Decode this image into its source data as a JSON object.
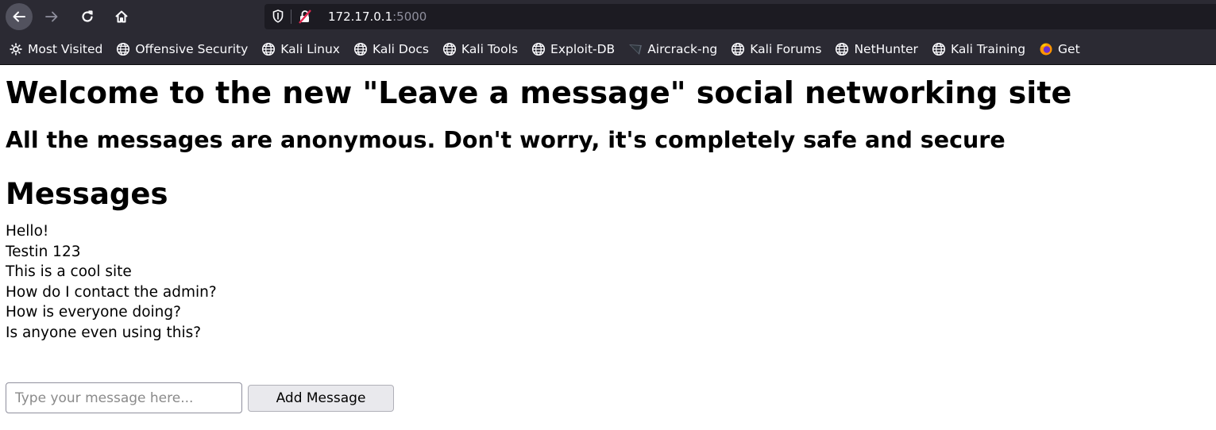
{
  "browser": {
    "url_host": "172.17.0.1",
    "url_port": ":5000",
    "nav_icons": [
      "back-arrow-icon",
      "forward-arrow-icon",
      "reload-icon",
      "home-icon"
    ],
    "bookmarks": [
      {
        "label": "Most Visited",
        "icon": "gear-icon"
      },
      {
        "label": "Offensive Security",
        "icon": "globe-icon"
      },
      {
        "label": "Kali Linux",
        "icon": "globe-icon"
      },
      {
        "label": "Kali Docs",
        "icon": "globe-icon"
      },
      {
        "label": "Kali Tools",
        "icon": "globe-icon"
      },
      {
        "label": "Exploit-DB",
        "icon": "globe-icon"
      },
      {
        "label": "Aircrack-ng",
        "icon": "aircrack-icon"
      },
      {
        "label": "Kali Forums",
        "icon": "globe-icon"
      },
      {
        "label": "NetHunter",
        "icon": "globe-icon"
      },
      {
        "label": "Kali Training",
        "icon": "globe-icon"
      },
      {
        "label": "Get",
        "icon": "firefox-icon"
      }
    ]
  },
  "page": {
    "title": "Welcome to the new \"Leave a message\" social networking site",
    "subtitle": "All the messages are anonymous. Don't worry, it's completely safe and secure",
    "messages_heading": "Messages",
    "messages": [
      "Hello!",
      "Testin 123",
      "This is a cool site",
      "How do I contact the admin?",
      "How is everyone doing?",
      "Is anyone even using this?"
    ],
    "form": {
      "input_placeholder": "Type your message here...",
      "input_value": "",
      "button_label": "Add Message"
    }
  }
}
